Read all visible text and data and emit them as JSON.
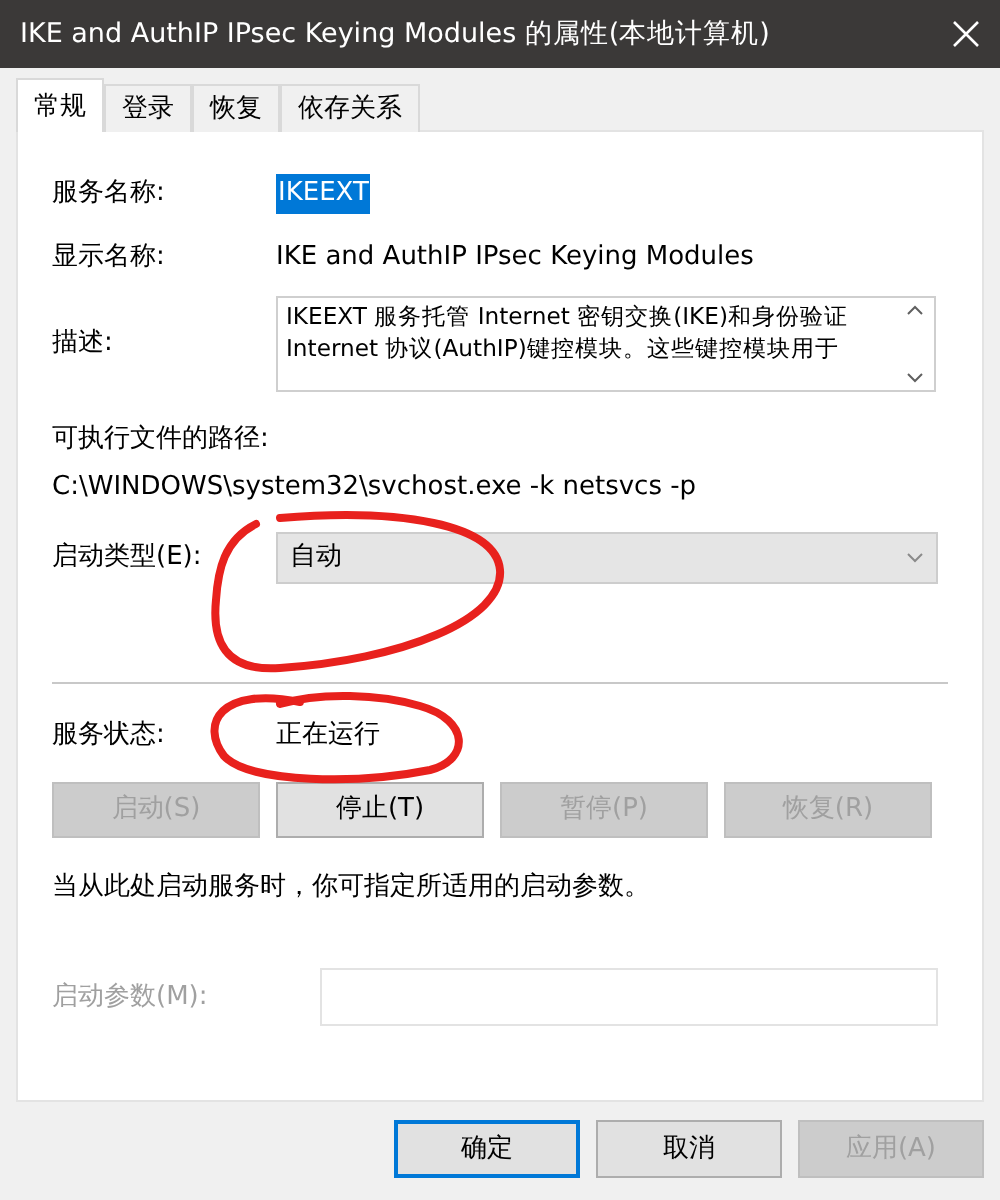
{
  "window": {
    "title": "IKE and AuthIP IPsec Keying Modules 的属性(本地计算机)"
  },
  "tabs": [
    {
      "label": "常规",
      "selected": true
    },
    {
      "label": "登录",
      "selected": false
    },
    {
      "label": "恢复",
      "selected": false
    },
    {
      "label": "依存关系",
      "selected": false
    }
  ],
  "fields": [
    {
      "label": "服务名称:",
      "value": "IKEEXT",
      "highlighted": true
    },
    {
      "label": "显示名称:",
      "value": "IKE and AuthIP IPsec Keying Modules",
      "highlighted": false
    }
  ],
  "description": {
    "label": "描述:",
    "lines": [
      "IKEEXT 服务托管 Internet 密钥交换(IKE)和身份验证",
      "Internet 协议(AuthIP)键控模块。这些键控模块用于"
    ]
  },
  "path": {
    "label": "可执行文件的路径:",
    "value": "C:\\WINDOWS\\system32\\svchost.exe -k netsvcs -p"
  },
  "startup_type": {
    "label": "启动类型(E):",
    "value": "自动"
  },
  "status": {
    "label": "服务状态:",
    "value": "正在运行"
  },
  "service_buttons": [
    {
      "label": "启动(S)",
      "disabled": true
    },
    {
      "label": "停止(T)",
      "disabled": false
    },
    {
      "label": "暂停(P)",
      "disabled": true
    },
    {
      "label": "恢复(R)",
      "disabled": true
    }
  ],
  "hint": "当从此处启动服务时，你可指定所适用的启动参数。",
  "start_params": {
    "label": "启动参数(M):",
    "disabled": true
  },
  "dialog_buttons": [
    {
      "label": "确定",
      "default": true,
      "disabled": false
    },
    {
      "label": "取消",
      "default": false,
      "disabled": false
    },
    {
      "label": "应用(A)",
      "default": false,
      "disabled": true
    }
  ],
  "annotations": [
    {
      "kind": "circle"
    },
    {
      "kind": "circle"
    }
  ]
}
